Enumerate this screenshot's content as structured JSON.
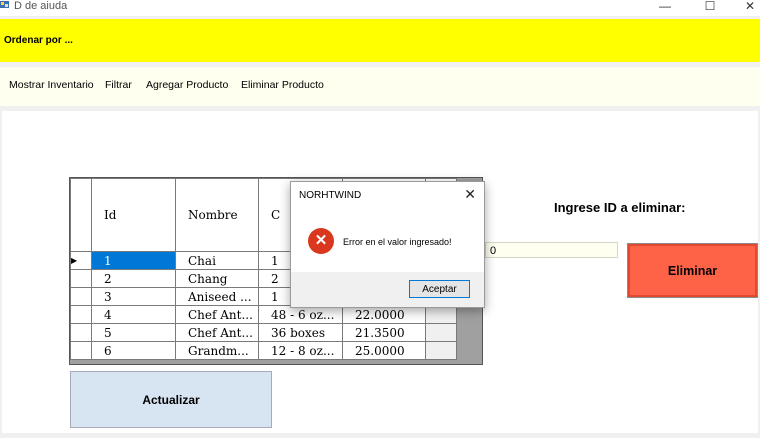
{
  "window": {
    "title": "D de aiuda",
    "minimize": "—",
    "maximize": "☐",
    "close": "✕"
  },
  "topbar": {
    "label": "Ordenar por ..."
  },
  "menu": {
    "items": [
      "Mostrar Inventario",
      "Filtrar",
      "Agregar Producto",
      "Eliminar Producto"
    ]
  },
  "grid": {
    "headers": {
      "id": "Id",
      "nombre": "Nombre",
      "cantidad": "C",
      "precio": ""
    },
    "rows": [
      {
        "id": "1",
        "nombre": "Chai",
        "cantidad": "1",
        "precio": ""
      },
      {
        "id": "2",
        "nombre": "Chang",
        "cantidad": "2",
        "precio": ""
      },
      {
        "id": "3",
        "nombre": "Aniseed ...",
        "cantidad": "1",
        "precio": ""
      },
      {
        "id": "4",
        "nombre": "Chef Ant...",
        "cantidad": "48 - 6 oz...",
        "precio": "22.0000"
      },
      {
        "id": "5",
        "nombre": "Chef Ant...",
        "cantidad": "36 boxes",
        "precio": "21.3500"
      },
      {
        "id": "6",
        "nombre": "Grandm...",
        "cantidad": "12 - 8 oz...",
        "precio": "25.0000"
      }
    ],
    "selected_marker": "▶"
  },
  "delete_panel": {
    "label": "Ingrese ID a eliminar:",
    "input_value": "0",
    "button": "Eliminar"
  },
  "actualizar_button": "Actualizar",
  "dialog": {
    "title": "NORHTWIND",
    "close": "✕",
    "icon": "✕",
    "message": "Error en el valor ingresado!",
    "ok": "Aceptar"
  },
  "colors": {
    "topbar": "#ffff00",
    "eliminar": "#ff6347",
    "actualizar": "#d7e4f2",
    "selection": "#0078d7",
    "error_icon": "#d9381e"
  }
}
